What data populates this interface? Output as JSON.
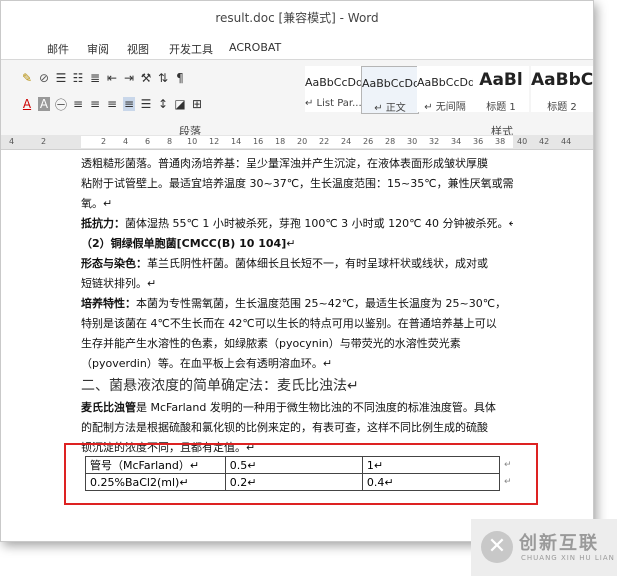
{
  "window": {
    "title": "result.doc [兼容模式] - Word"
  },
  "ribbon_tabs": [
    "邮件",
    "审阅",
    "视图",
    "开发工具",
    "ACROBAT"
  ],
  "ribbon": {
    "font_row1": [
      "A",
      "⁄",
      "A",
      "A"
    ],
    "font_row2": [
      "A",
      "A"
    ],
    "para_label": "段落",
    "styles_label": "样式",
    "styles": [
      {
        "preview": "AaBbCcDd",
        "name": "↵ List Par..."
      },
      {
        "preview": "AaBbCcDd",
        "name": "↵ 正文"
      },
      {
        "preview": "AaBbCcDd",
        "name": "↵ 无间隔"
      },
      {
        "preview": "AaBl",
        "name": "标题 1"
      },
      {
        "preview": "AaBbC",
        "name": "标题 2"
      }
    ]
  },
  "ruler": {
    "ticks": [
      "4",
      "2",
      "2",
      "4",
      "6",
      "8",
      "10",
      "12",
      "14",
      "16",
      "18",
      "20",
      "22",
      "24",
      "26",
      "28",
      "30",
      "32",
      "34",
      "36",
      "38",
      "40",
      "42",
      "44"
    ]
  },
  "doc": {
    "lines": [
      {
        "label": "",
        "text": "透粗糙形菌落。普通肉汤培养基：呈少量浑浊并产生沉淀，在液体表面形成皱状厚膜"
      },
      {
        "label": "",
        "text": "粘附于试管壁上。最适宜培养温度 30~37℃，生长温度范围：15~35℃，兼性厌氧或需"
      },
      {
        "label": "",
        "text": "氧。↵"
      },
      {
        "label": "抵抗力：",
        "text": "菌体湿热 55℃ 1 小时被杀死，芽孢 100℃ 3 小时或 120℃ 40 分钟被杀死。↵"
      },
      {
        "label": "（2）铜绿假单胞菌[CMCC(B) 10 104]",
        "text": "↵"
      },
      {
        "label": "形态与染色：",
        "text": "革兰氏阴性杆菌。菌体细长且长短不一，有时呈球杆状或线状，成对或"
      },
      {
        "label": "",
        "text": "短链状排列。↵"
      },
      {
        "label": "培养特性：",
        "text": "本菌为专性需氧菌，生长温度范围 25~42℃，最适生长温度为 25~30℃，"
      },
      {
        "label": "",
        "text": "特别是该菌在 4℃不生长而在 42℃可以生长的特点可用以鉴别。在普通培养基上可以"
      },
      {
        "label": "",
        "text": "生存并能产生水溶性的色素，如绿脓素（pyocynin）与带荧光的水溶性荧光素"
      },
      {
        "label": "",
        "text": "（pyoverdin）等。在血平板上会有透明溶血环。↵"
      }
    ],
    "heading": "二、菌悬液浓度的简单确定法：麦氏比浊法↵",
    "para2": [
      {
        "label": "麦氏比浊管",
        "text": "是 McFarland 发明的一种用于微生物比浊的不同浊度的标准浊度管。具体"
      },
      {
        "label": "",
        "text": "的配制方法是根据硫酸和氯化钡的比例来定的，有表可查，这样不同比例生成的硫酸"
      },
      {
        "label": "",
        "text": "钡沉淀的浓度不同，且都有定值。↵"
      }
    ],
    "table": [
      [
        "管号（McFarland）↵",
        "0.5↵",
        "1↵",
        "↵"
      ],
      [
        "0.25%BaCl2(ml)↵",
        "0.2↵",
        "0.4↵",
        "↵"
      ]
    ]
  },
  "watermark": {
    "title": "创新互联",
    "subtitle": "CHUANG XIN HU LIAN"
  }
}
